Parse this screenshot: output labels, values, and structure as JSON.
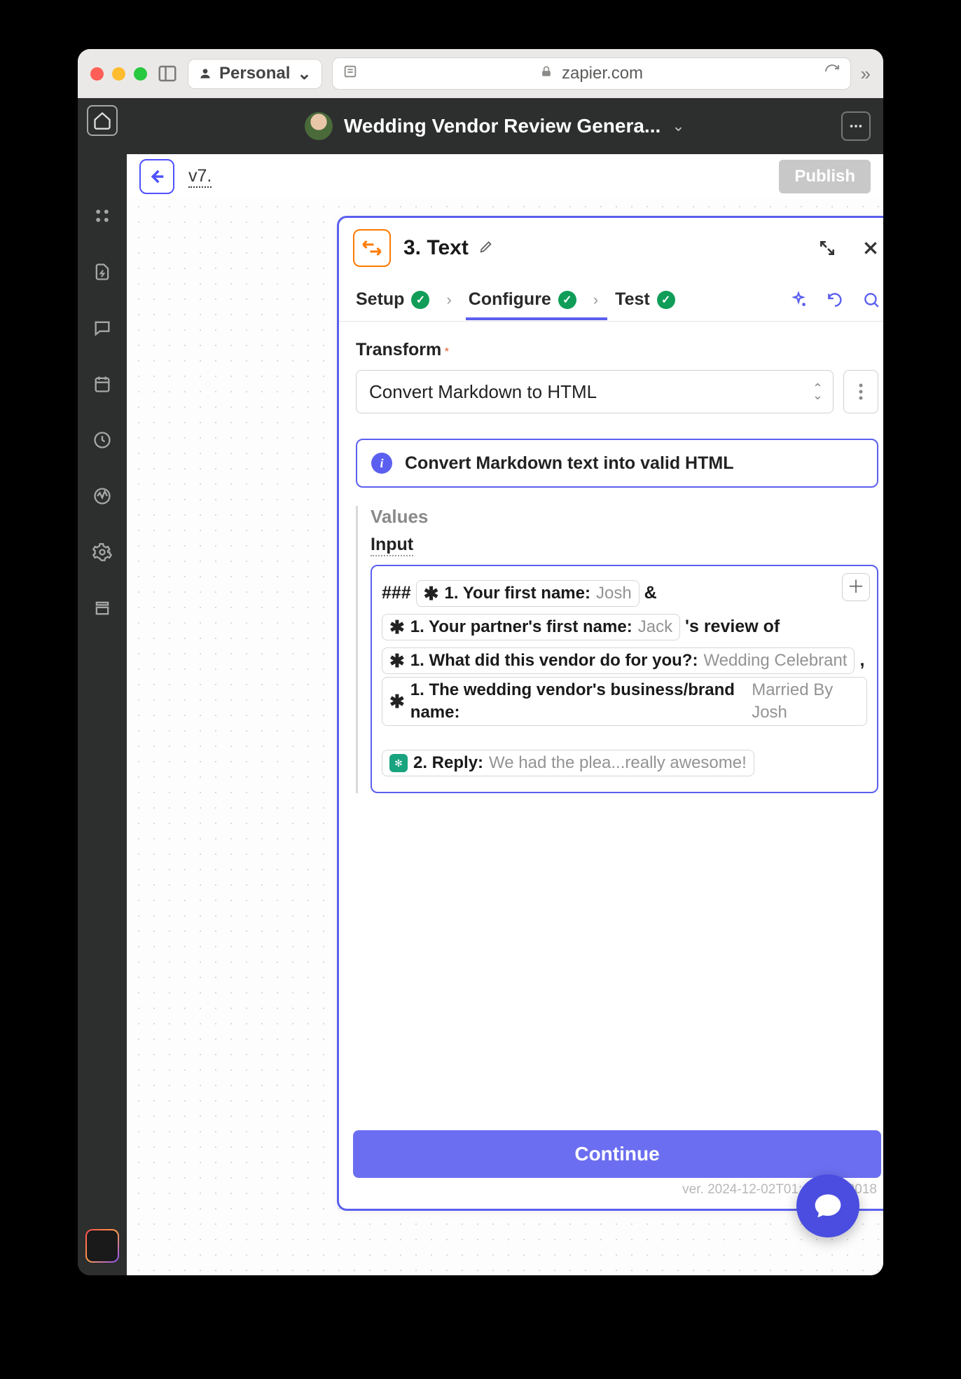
{
  "browser": {
    "profile": "Personal",
    "url": "zapier.com"
  },
  "topbar": {
    "title": "Wedding Vendor Review Genera..."
  },
  "canvasHeader": {
    "version": "v7.",
    "publish": "Publish"
  },
  "step": {
    "number": "3.",
    "name": "Text"
  },
  "tabs": {
    "setup": "Setup",
    "configure": "Configure",
    "test": "Test"
  },
  "form": {
    "transformLabel": "Transform",
    "transformValue": "Convert Markdown to HTML",
    "infoText": "Convert Markdown text into valid HTML",
    "valuesLabel": "Values",
    "inputLabel": "Input",
    "rawHash": "###",
    "amp": "&",
    "review_of": "'s review of",
    "comma": ",",
    "pills": {
      "firstNameKey": "1. Your first name:",
      "firstNameVal": "Josh",
      "partnerKey": "1. Your partner's first name:",
      "partnerVal": "Jack",
      "whatKey": "1. What did this vendor do for you?:",
      "whatVal": "Wedding Celebrant",
      "brandKey": "1. The wedding vendor's business/brand name:",
      "brandVal": "Married By Josh",
      "replyKey": "2. Reply:",
      "replyVal": "We had the plea...really awesome!"
    }
  },
  "footer": {
    "continue": "Continue",
    "version": "ver. 2024-12-02T01:49-32f22018"
  }
}
